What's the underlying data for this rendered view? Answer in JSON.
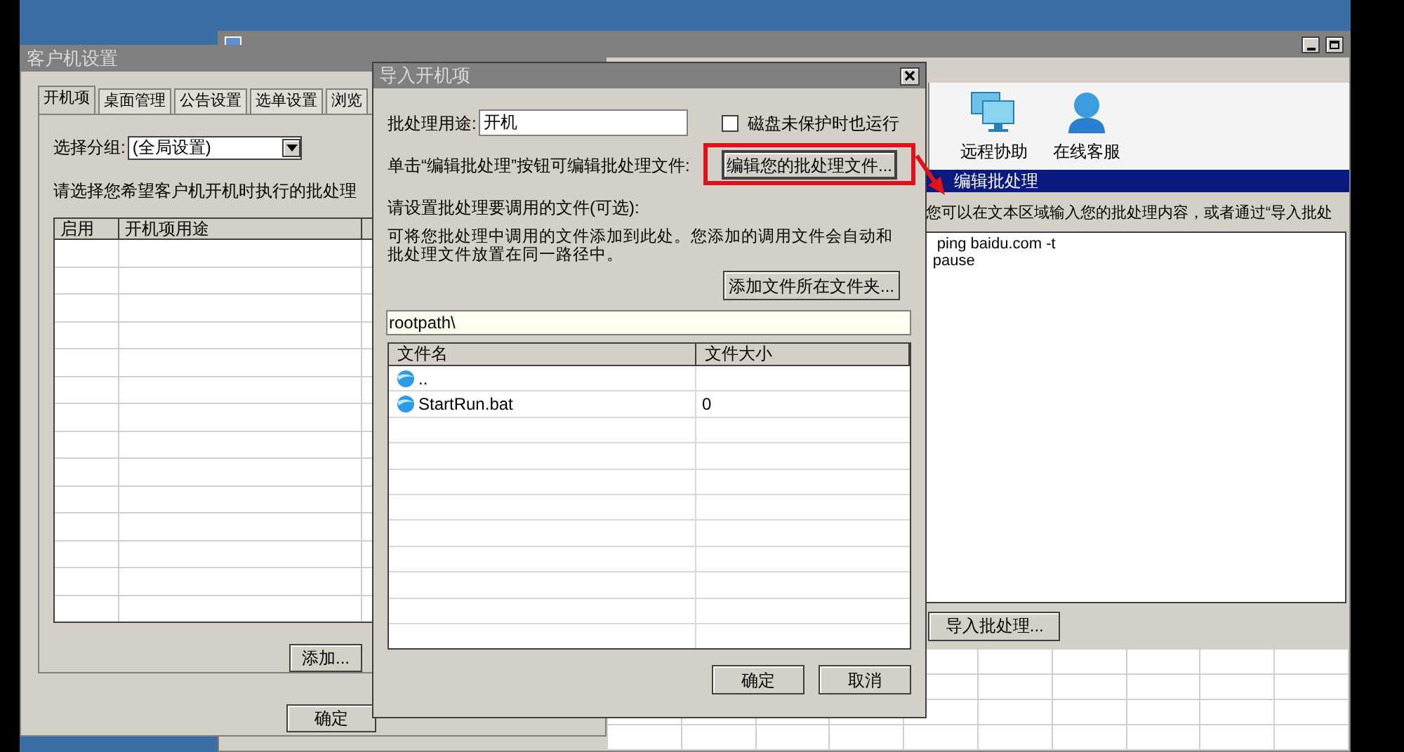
{
  "console_window": {
    "toolbar": [
      {
        "label": "远程协助",
        "kind": "remote"
      },
      {
        "label": "在线客服",
        "kind": "support"
      }
    ],
    "edit_panel": {
      "title": "编辑批处理",
      "hint": "您可以在文本区域输入您的批处理内容，或者通过“导入批处",
      "content": " ping baidu.com -t\npause",
      "import_button": "导入批处理..."
    }
  },
  "settings_window": {
    "title": "客户机设置",
    "tabs": [
      {
        "label": "开机项",
        "selected": true
      },
      {
        "label": "桌面管理",
        "selected": false
      },
      {
        "label": "公告设置",
        "selected": false
      },
      {
        "label": "选单设置",
        "selected": false
      },
      {
        "label": "浏览",
        "selected": false
      }
    ],
    "group_label": "选择分组:",
    "group_value": "(全局设置)",
    "instruction": "请选择您希望客户机开机时执行的批处理",
    "columns": [
      "启用",
      "开机项用途"
    ],
    "add_button": "添加...",
    "ok_button": "确定"
  },
  "import_dialog": {
    "title": "导入开机项",
    "purpose_label": "批处理用途:",
    "purpose_value": "开机",
    "unprotected_run": {
      "label": "磁盘未保护时也运行",
      "checked": false
    },
    "edit_hint": "单击“编辑批处理”按钮可编辑批处理文件:",
    "edit_button": {
      "label": "编辑您的批处理文件...",
      "highlighted": true
    },
    "files_label": "请设置批处理要调用的文件(可选):",
    "files_note": "可将您批处理中调用的文件添加到此处。您添加的调用文件会自动和批处理文件放置在同一路径中。",
    "add_folder_button": "添加文件所在文件夹...",
    "path": "rootpath\\",
    "columns": [
      "文件名",
      "文件大小"
    ],
    "files": [
      {
        "name": ".."
      },
      {
        "name": "StartRun.bat",
        "size": "0"
      }
    ],
    "ok_button": "确定",
    "cancel_button": "取消"
  }
}
